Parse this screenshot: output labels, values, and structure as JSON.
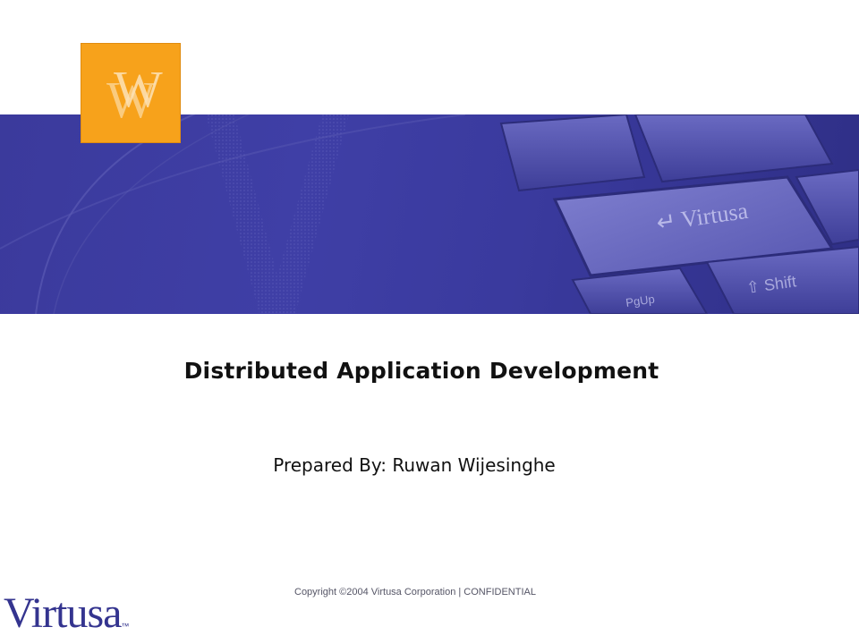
{
  "slide": {
    "title": "Distributed Application Development",
    "subtitle": "Prepared By: Ruwan Wijesinghe",
    "copyright": "Copyright ©2004 Virtusa Corporation | CONFIDENTIAL",
    "brand": {
      "name": "Virtusa",
      "trademark": "™"
    },
    "banner": {
      "keys": [
        "Virtusa",
        "Shift",
        "PgUp"
      ]
    },
    "logo_box": {
      "letters": "VV"
    }
  },
  "colors": {
    "banner_blue": "#3b3a9c",
    "logo_orange": "#f7a21b",
    "brand_blue": "#34348f",
    "text": "#111111"
  }
}
